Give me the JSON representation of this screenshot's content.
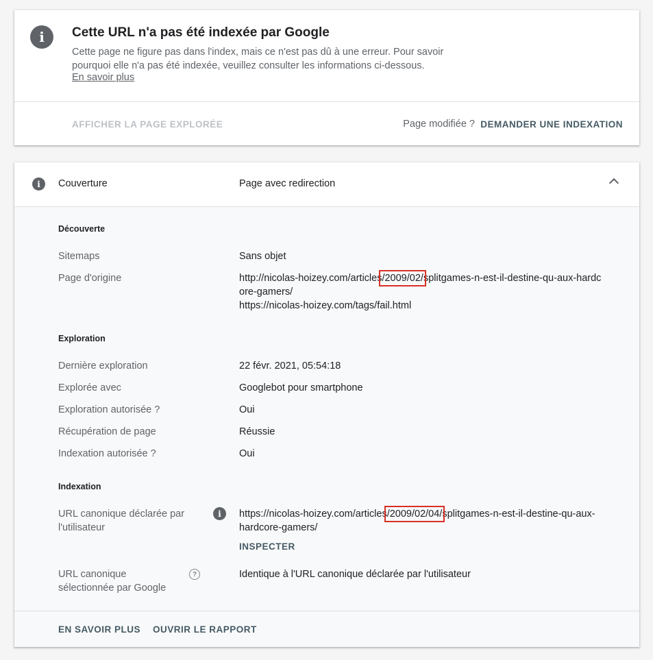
{
  "status_card": {
    "title": "Cette URL n'a pas été indexée par Google",
    "description": "Cette page ne figure pas dans l'index, mais ce n'est pas dû à une erreur. Pour savoir pourquoi elle n'a pas été indexée, veuillez consulter les informations ci-dessous.",
    "learn_more": "En savoir plus",
    "view_crawled_label": "AFFICHER LA PAGE EXPLORÉE",
    "page_modified_label": "Page modifiée ?",
    "request_indexing_label": "DEMANDER UNE INDEXATION",
    "icon": "info-icon"
  },
  "coverage": {
    "label": "Couverture",
    "value": "Page avec redirection",
    "icon": "info-icon",
    "toggle_icon": "chevron-up-icon"
  },
  "discovery": {
    "title": "Découverte",
    "sitemaps_label": "Sitemaps",
    "sitemaps_value": "Sans objet",
    "referring_label": "Page d'origine",
    "referring_url1_a": "http://nicolas-hoizey.com/articles",
    "referring_url1_hl": "/2009/02/",
    "referring_url1_b": "splitgames-n-est-il-destine-qu-aux-hardc",
    "referring_url1_c": "ore-gamers/",
    "referring_url2": "https://nicolas-hoizey.com/tags/fail.html"
  },
  "crawl": {
    "title": "Exploration",
    "rows": [
      {
        "label": "Dernière exploration",
        "value": "22 févr. 2021, 05:54:18"
      },
      {
        "label": "Explorée avec",
        "value": "Googlebot pour smartphone"
      },
      {
        "label": "Exploration autorisée ?",
        "value": "Oui"
      },
      {
        "label": "Récupération de page",
        "value": "Réussie"
      },
      {
        "label": "Indexation autorisée ?",
        "value": "Oui"
      }
    ]
  },
  "indexing": {
    "title": "Indexation",
    "user_canonical_label_1": "URL canonique déclarée par",
    "user_canonical_label_2": "l'utilisateur",
    "user_canonical_a": "https://nicolas-hoizey.com/articles",
    "user_canonical_hl": "/2009/02/04/",
    "user_canonical_b": "splitgames-n-est-il-destine-qu-aux-",
    "user_canonical_c": "hardcore-gamers/",
    "inspect_label": "INSPECTER",
    "google_canonical_label_1": "URL canonique",
    "google_canonical_label_2": "sélectionnée par Google",
    "google_canonical_value": "Identique à l'URL canonique déclarée par l'utilisateur",
    "info_icon": "info-icon",
    "help_icon": "help-icon"
  },
  "footer": {
    "learn_more": "EN SAVOIR PLUS",
    "open_report": "OUVRIR LE RAPPORT"
  },
  "colors": {
    "highlight": "#d93025",
    "button_text": "#455a64",
    "secondary_text": "#5f6368"
  }
}
